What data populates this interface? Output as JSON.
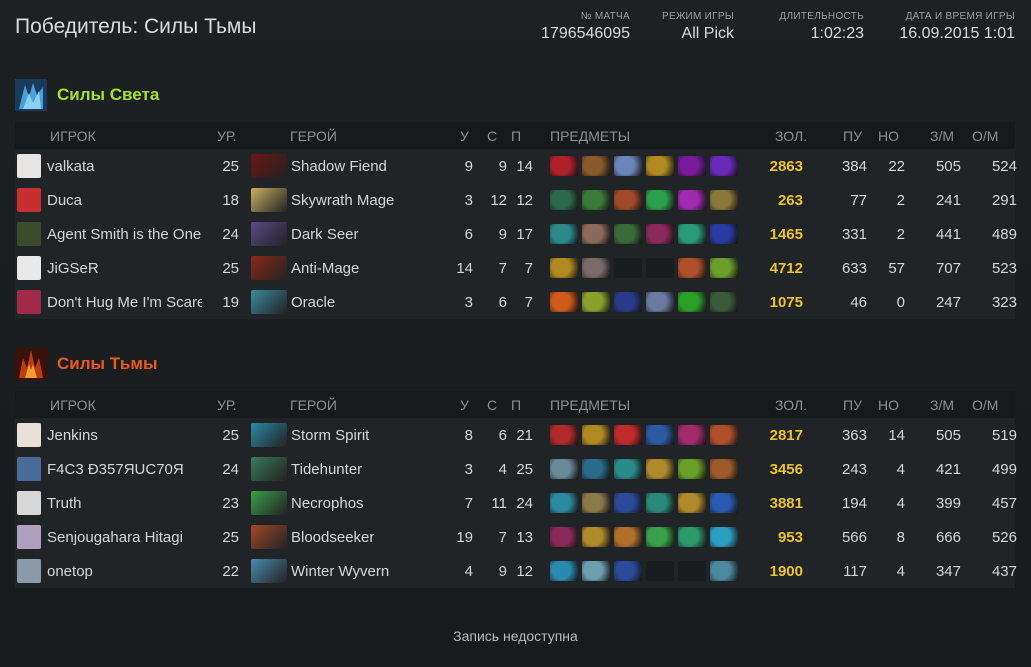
{
  "header": {
    "title": "Победитель: Силы Тьмы",
    "match_label": "№ МАТЧА",
    "match_id": "1796546095",
    "mode_label": "РЕЖИМ ИГРЫ",
    "mode": "All Pick",
    "duration_label": "ДЛИТЕЛЬНОСТЬ",
    "duration": "1:02:23",
    "date_label": "ДАТА И ВРЕМЯ ИГРЫ",
    "date": "16.09.2015 1:01"
  },
  "columns": {
    "player": "ИГРОК",
    "level": "УР.",
    "hero": "ГЕРОЙ",
    "k": "У",
    "d": "С",
    "a": "П",
    "items": "ПРЕДМЕТЫ",
    "gold": "ЗОЛ.",
    "lh": "ПУ",
    "dn": "НО",
    "gpm": "З/М",
    "xpm": "О/М"
  },
  "radiant": {
    "name": "Силы Света",
    "players": [
      {
        "name": "valkata",
        "level": "25",
        "hero": "Shadow Fiend",
        "k": "9",
        "d": "9",
        "a": "14",
        "gold": "2863",
        "lh": "384",
        "dn": "22",
        "gpm": "505",
        "xpm": "524",
        "avatar": "#e9e4e4",
        "hero_color": "#6a1414",
        "items": [
          "#b0202a",
          "#8a5a2a",
          "#6a86b8",
          "#b08a20",
          "#7a1a9a",
          "#6a2ab8"
        ]
      },
      {
        "name": "Duca",
        "level": "18",
        "hero": "Skywrath Mage",
        "k": "3",
        "d": "12",
        "a": "12",
        "gold": "263",
        "lh": "77",
        "dn": "2",
        "gpm": "241",
        "xpm": "291",
        "avatar": "#c83030",
        "hero_color": "#c8b060",
        "items": [
          "#2a6a4a",
          "#3a7a3a",
          "#a04a2a",
          "#2aa04a",
          "#a02ab0",
          "#8a7a3a"
        ]
      },
      {
        "name": "Agent Smith is the One",
        "level": "24",
        "hero": "Dark Seer",
        "k": "6",
        "d": "9",
        "a": "17",
        "gold": "1465",
        "lh": "331",
        "dn": "2",
        "gpm": "441",
        "xpm": "489",
        "avatar": "#3a4a2a",
        "hero_color": "#5a4a8a",
        "items": [
          "#2a8a8a",
          "#8a6a5a",
          "#3a6a3a",
          "#8a2a5a",
          "#2a9a7a",
          "#2a3aa0"
        ]
      },
      {
        "name": "JiGSeR",
        "level": "25",
        "hero": "Anti-Mage",
        "k": "14",
        "d": "7",
        "a": "7",
        "gold": "4712",
        "lh": "633",
        "dn": "57",
        "gpm": "707",
        "xpm": "523",
        "avatar": "#e8e8e8",
        "hero_color": "#8a2a1a",
        "items": [
          "#b08a20",
          "#7a6a6a",
          "",
          "",
          "#b0502a",
          "#6aa02a"
        ]
      },
      {
        "name": "Don't Hug Me I'm Scared",
        "level": "19",
        "hero": "Oracle",
        "k": "3",
        "d": "6",
        "a": "7",
        "gold": "1075",
        "lh": "46",
        "dn": "0",
        "gpm": "247",
        "xpm": "323",
        "avatar": "#a02a4a",
        "hero_color": "#3a8aa0",
        "items": [
          "#d05a1a",
          "#8aa02a",
          "#2a3a8a",
          "#6a7aa0",
          "#2aa02a",
          "#3a5a3a"
        ]
      }
    ]
  },
  "dire": {
    "name": "Силы Тьмы",
    "players": [
      {
        "name": "Jenkins",
        "level": "25",
        "hero": "Storm Spirit",
        "k": "8",
        "d": "6",
        "a": "21",
        "gold": "2817",
        "lh": "363",
        "dn": "14",
        "gpm": "505",
        "xpm": "519",
        "avatar": "#e8e0d8",
        "hero_color": "#2a8aa8",
        "items": [
          "#b02a2a",
          "#b08a20",
          "#c02a2a",
          "#2a5aa0",
          "#a02a6a",
          "#b0502a"
        ]
      },
      {
        "name": "F4C3 Ð357ЯUC70Я",
        "level": "24",
        "hero": "Tidehunter",
        "k": "3",
        "d": "4",
        "a": "25",
        "gold": "3456",
        "lh": "243",
        "dn": "4",
        "gpm": "421",
        "xpm": "499",
        "avatar": "#4a6a9a",
        "hero_color": "#3a7a5a",
        "items": [
          "#6a8a9a",
          "#2a6a8a",
          "#2a8a8a",
          "#b08a2a",
          "#6aa02a",
          "#a05a2a"
        ]
      },
      {
        "name": "Truth",
        "level": "23",
        "hero": "Necrophos",
        "k": "7",
        "d": "11",
        "a": "24",
        "gold": "3881",
        "lh": "194",
        "dn": "4",
        "gpm": "399",
        "xpm": "457",
        "avatar": "#d8d8d8",
        "hero_color": "#3aa04a",
        "items": [
          "#2a8aa0",
          "#8a7a4a",
          "#2a4a9a",
          "#2a8a7a",
          "#b08a2a",
          "#2a5ab0"
        ]
      },
      {
        "name": "Senjougahara Hitagi",
        "level": "25",
        "hero": "Bloodseeker",
        "k": "19",
        "d": "7",
        "a": "13",
        "gold": "953",
        "lh": "566",
        "dn": "8",
        "gpm": "666",
        "xpm": "526",
        "avatar": "#b0a0c0",
        "hero_color": "#a04a2a",
        "items": [
          "#8a2a5a",
          "#b08a2a",
          "#b0702a",
          "#3aa04a",
          "#2a9a6a",
          "#2aa0c0"
        ]
      },
      {
        "name": "onetop",
        "level": "22",
        "hero": "Winter Wyvern",
        "k": "4",
        "d": "9",
        "a": "12",
        "gold": "1900",
        "lh": "117",
        "dn": "4",
        "gpm": "347",
        "xpm": "437",
        "avatar": "#8a9aa8",
        "hero_color": "#4a8ab0",
        "items": [
          "#2a8ab0",
          "#6aa0b0",
          "#2a4a9a",
          "",
          "",
          "#4a8aa0"
        ]
      }
    ]
  },
  "footer": {
    "text": "Запись недоступна"
  },
  "colors": {
    "radiant": "#a5e22e",
    "dire": "#ea5a1c",
    "gold": "#ecc42b"
  },
  "icons": {
    "radiant": "radiant-emblem-icon",
    "dire": "dire-emblem-icon"
  }
}
